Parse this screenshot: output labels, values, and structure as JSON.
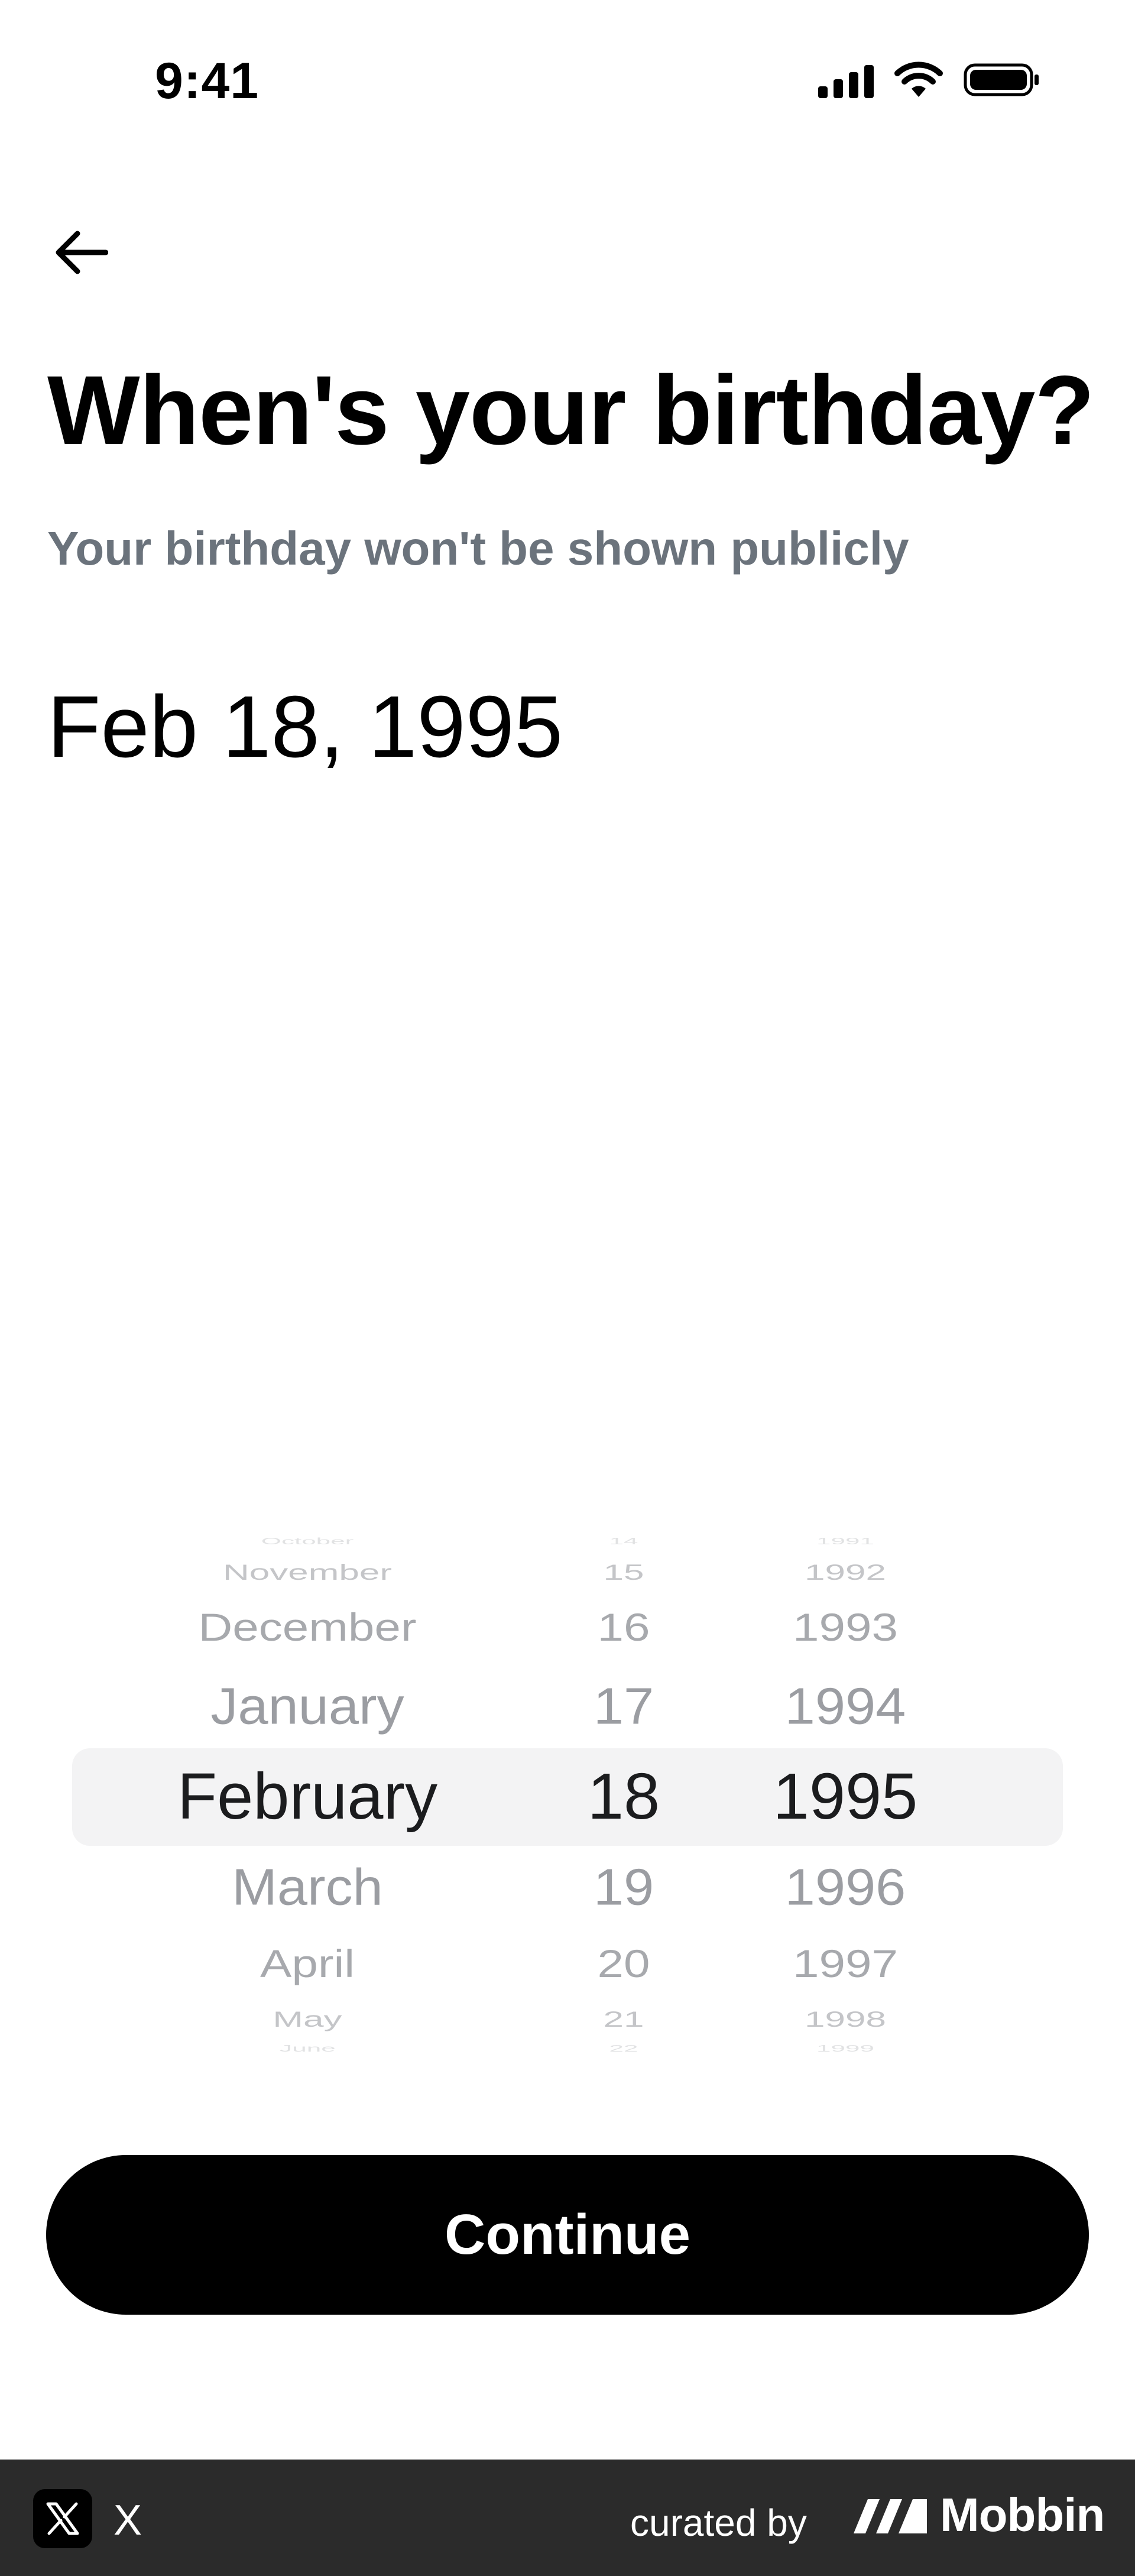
{
  "status_bar": {
    "time": "9:41"
  },
  "header": {
    "back_icon": "arrow-left-icon"
  },
  "main": {
    "title": "When's your birthday?",
    "subtitle": "Your birthday won't be shown publicly",
    "selected_date": "Feb 18, 1995"
  },
  "picker": {
    "rows": [
      {
        "month": "October",
        "day": "14",
        "year": "1991"
      },
      {
        "month": "November",
        "day": "15",
        "year": "1992"
      },
      {
        "month": "December",
        "day": "16",
        "year": "1993"
      },
      {
        "month": "January",
        "day": "17",
        "year": "1994"
      },
      {
        "month": "February",
        "day": "18",
        "year": "1995"
      },
      {
        "month": "March",
        "day": "19",
        "year": "1996"
      },
      {
        "month": "April",
        "day": "20",
        "year": "1997"
      },
      {
        "month": "May",
        "day": "21",
        "year": "1998"
      },
      {
        "month": "June",
        "day": "22",
        "year": "1999"
      }
    ]
  },
  "actions": {
    "continue_label": "Continue"
  },
  "footer": {
    "app_name": "X",
    "curated_by": "curated by",
    "brand": "Mobbin"
  }
}
